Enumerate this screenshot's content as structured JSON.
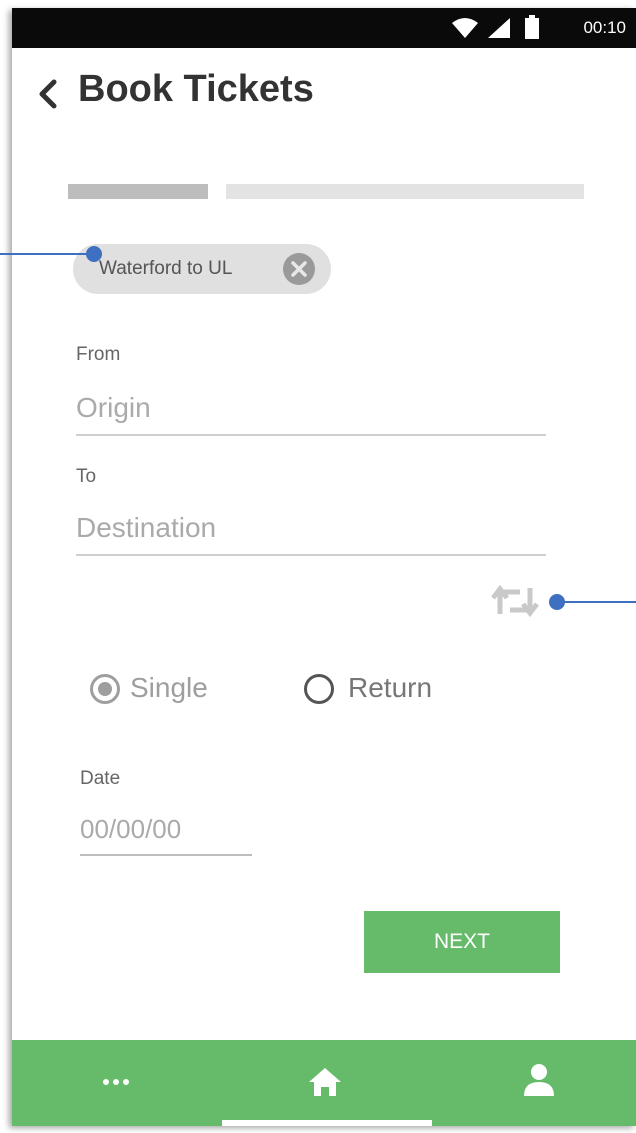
{
  "status_bar": {
    "time": "00:10",
    "icons": [
      "wifi-icon",
      "signal-icon",
      "battery-icon"
    ]
  },
  "header": {
    "back_icon": "chevron-left-icon",
    "title": "Book Tickets"
  },
  "progress": {
    "steps_total": 2,
    "current_step": 1
  },
  "chip": {
    "label": "Waterford to UL",
    "close_icon": "close-circle-icon"
  },
  "form": {
    "from": {
      "label": "From",
      "placeholder": "Origin"
    },
    "to": {
      "label": "To",
      "placeholder": "Destination"
    },
    "swap_icon": "swap-arrows-icon",
    "trip_type": {
      "options": [
        {
          "label": "Single",
          "selected": true
        },
        {
          "label": "Return",
          "selected": false
        }
      ]
    },
    "date": {
      "label": "Date",
      "placeholder": "00/00/00"
    },
    "next_label": "NEXT"
  },
  "bottom_nav": {
    "items": [
      {
        "icon": "more-dots-icon"
      },
      {
        "icon": "home-icon"
      },
      {
        "icon": "person-icon"
      }
    ]
  },
  "colors": {
    "accent_green": "#66bb6a",
    "status_bar": "#0a0a0a",
    "callout_blue": "#3f6fc0",
    "placeholder_gray": "#aaaaaa"
  }
}
